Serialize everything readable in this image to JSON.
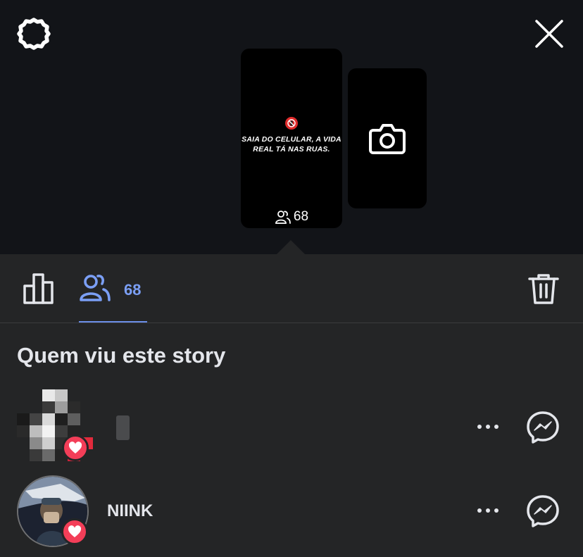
{
  "header": {
    "settings_icon": "gear-icon",
    "close_icon": "close-icon"
  },
  "story_preview": {
    "caption": "SAIA DO CELULAR, A VIDA REAL TÁ NAS RUAS.",
    "viewer_count": "68",
    "add_icon": "camera-icon"
  },
  "tabs": {
    "insights_icon": "bar-chart-icon",
    "viewers_icon": "people-icon",
    "viewers_count": "68",
    "trash_icon": "trash-icon"
  },
  "viewers_section": {
    "title": "Quem viu este story",
    "viewers": [
      {
        "name": "",
        "reaction": "heart",
        "avatar": "pixelated"
      },
      {
        "name": "NIINK",
        "reaction": "heart",
        "avatar": "photo"
      }
    ]
  },
  "colors": {
    "accent": "#7b9ff5",
    "background": "#242526",
    "top_background": "#121418",
    "like": "#f33e58"
  }
}
